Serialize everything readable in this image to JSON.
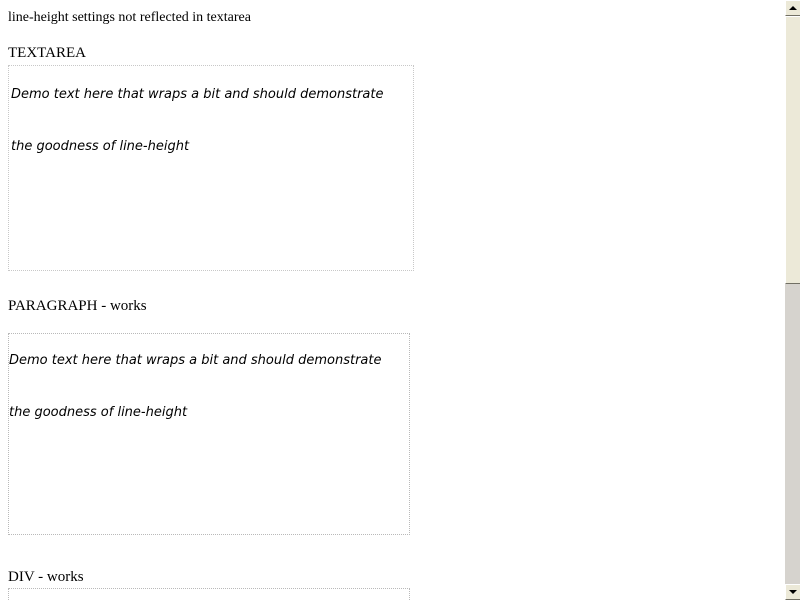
{
  "page": {
    "title": "line-height settings not reflected in textarea"
  },
  "sections": {
    "textarea": {
      "label": "TEXTAREA",
      "lines": [
        "Demo text here that wraps a bit and should demonstrate",
        "the goodness of line-height"
      ]
    },
    "paragraph": {
      "label": "PARAGRAPH - works",
      "lines": [
        "Demo text here that wraps a bit and should demonstrate",
        "the goodness of line-height"
      ]
    },
    "div": {
      "label": "DIV - works"
    }
  },
  "scrollbar": {
    "position": 0,
    "visible_fraction": 0.47
  },
  "colors": {
    "box_border": "#b9b9b9",
    "scrollbar_face": "#ece9d8",
    "scrollbar_track": "#d6d3ce"
  }
}
